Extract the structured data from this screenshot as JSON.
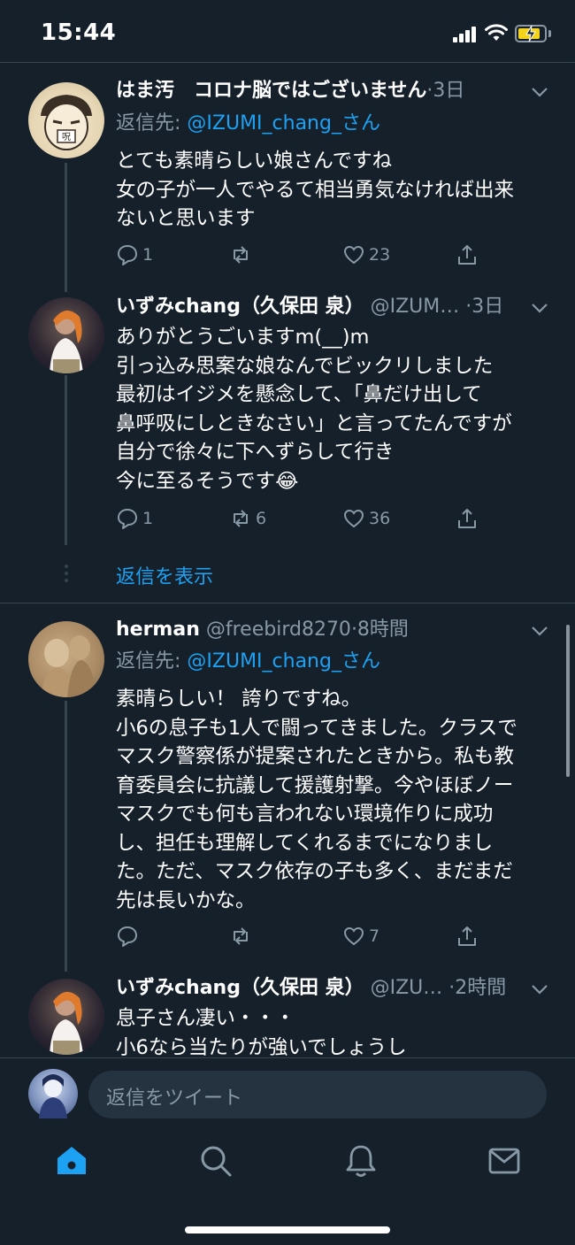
{
  "status_bar": {
    "time": "15:44"
  },
  "colors": {
    "background": "#15202b",
    "accent": "#1da1f2",
    "secondary_text": "#8899a6",
    "battery": "#f5d31c"
  },
  "tweets": [
    {
      "name": "はま汚　コロナ脳ではございません",
      "handle": "",
      "time": "·3日",
      "reply_prefix": "返信先: ",
      "reply_mention": "@IZUMI_chang_さん",
      "body": [
        "とても素晴らしい娘さんですね",
        "女の子が一人でやるて相当勇気なければ出来",
        "ないと思います"
      ],
      "replies": "1",
      "retweets": "",
      "likes": "23"
    },
    {
      "name": "いずみchang（久保田 泉）",
      "handle": " @IZUM…",
      "time": " ·3日",
      "reply_prefix": "",
      "reply_mention": "",
      "body": [
        "ありがとうごいますm(__)m",
        "引っ込み思案な娘なんでビックリしました",
        "最初はイジメを懸念して、「鼻だけ出して",
        "鼻呼吸にしときなさい」と言ってたんですが",
        "自分で徐々に下へずらして行き",
        "今に至るそうです😂"
      ],
      "replies": "1",
      "retweets": "6",
      "likes": "36"
    },
    {
      "name": "herman",
      "handle": " @freebird8270",
      "time": "·8時間",
      "reply_prefix": "返信先: ",
      "reply_mention": "@IZUMI_chang_さん",
      "body": [
        "素晴らしい！ 誇りですね。",
        "小6の息子も1人で闘ってきました。クラスで",
        "マスク警察係が提案されたときから。私も教",
        "育委員会に抗議して援護射撃。今やほぼノー",
        "マスクでも何も言われない環境作りに成功",
        "し、担任も理解してくれるまでになりまし",
        "た。ただ、マスク依存の子も多く、まだまだ",
        "先は長いかな。"
      ],
      "replies": "",
      "retweets": "",
      "likes": "7"
    },
    {
      "name": "いずみchang（久保田 泉）",
      "handle": " @IZU…",
      "time": " ·2時間",
      "reply_prefix": "",
      "reply_mention": "",
      "body": [
        "息子さん凄い・・・",
        "小6なら当たりが強いでしょうし"
      ],
      "replies": "",
      "retweets": "",
      "likes": ""
    }
  ],
  "show_replies_label": "返信を表示",
  "composer": {
    "placeholder": "返信をツイート"
  },
  "tabs": [
    "home-icon",
    "search-icon",
    "notifications-icon",
    "messages-icon"
  ]
}
